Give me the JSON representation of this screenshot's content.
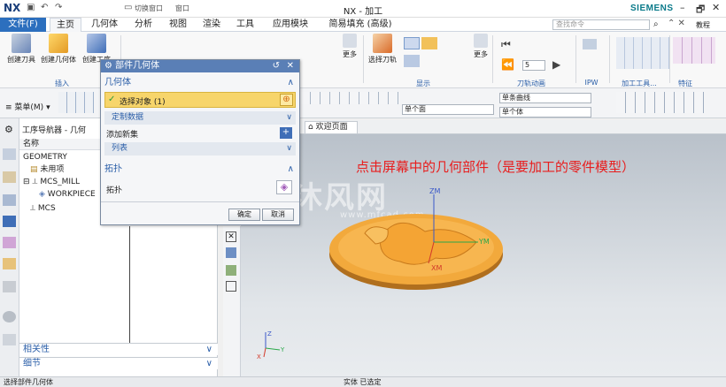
{
  "app": {
    "logo": "NX",
    "title": "NX - 加工",
    "brand": "SIEMENS",
    "quick_switch_window": "切换窗口",
    "quick_window": "窗口",
    "win_controls": [
      "–",
      "🗗",
      "✕"
    ]
  },
  "menubar": {
    "file": "文件(F)",
    "tabs": [
      "主页",
      "几何体",
      "分析",
      "视图",
      "渲染",
      "工具",
      "应用模块",
      "简易填充 (高级)"
    ],
    "active_tab": "主页",
    "search_placeholder": "查找命令",
    "tutorial": "教程"
  },
  "ribbon": {
    "buttons": [
      "创建刀具",
      "创建几何体",
      "创建工序",
      "更多",
      "选择刀轨",
      "更多"
    ],
    "groups": [
      "插入",
      "显示",
      "刀轨动画",
      "IPW",
      "加工工具...",
      "特征"
    ],
    "anim_speed": "5"
  },
  "toolbar2": {
    "menu": "菜单(M)",
    "face_filter": "单个面",
    "curve_rule": "单条曲线",
    "body_rule": "单个体"
  },
  "navigator": {
    "title": "工序导航器 - 几何",
    "column": "名称",
    "items": [
      "GEOMETRY",
      "未用项",
      "MCS_MILL",
      "WORKPIECE",
      "MCS"
    ],
    "panels": [
      "相关性",
      "细节"
    ]
  },
  "viewport": {
    "tab": "欢迎页面",
    "annotation": "点击屏幕中的几何部件（是要加工的零件模型）",
    "watermark": "沐风网",
    "watermark_url": "www.mfcad.com",
    "axes": {
      "zm": "ZM",
      "ym": "YM",
      "xm": "XM",
      "z": "Z",
      "y": "Y",
      "x": "X"
    }
  },
  "dialog": {
    "title": "部件几何体",
    "section_geometry": "几何体",
    "select_object": "选择对象 (1)",
    "custom_data": "定制数据",
    "add_new_set": "添加新集",
    "list": "列表",
    "section_topology": "拓扑",
    "topology_label": "拓扑",
    "ok": "确定",
    "cancel": "取消"
  },
  "status": {
    "left": "选择部件几何体",
    "center": "实体 已选定"
  },
  "colors": {
    "accent": "#2c6fbe",
    "highlight": "#f7d56b",
    "part": "#f2a93c",
    "annotation": "#e81e1e"
  }
}
